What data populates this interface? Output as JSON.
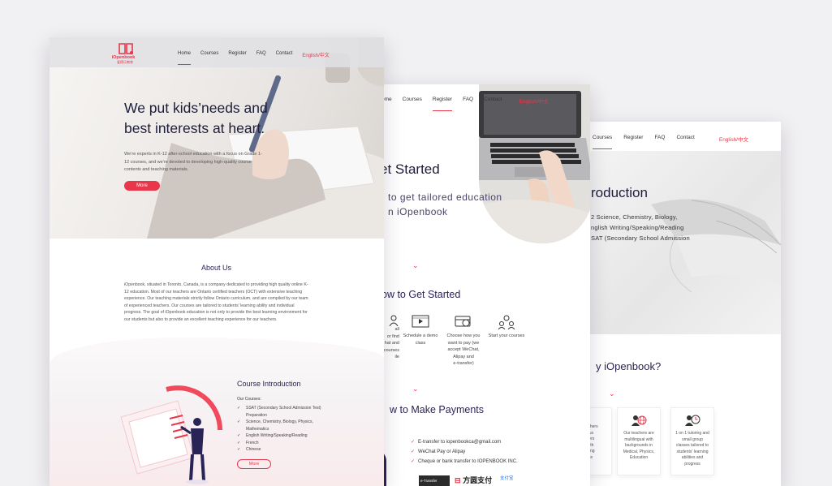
{
  "frame3": {
    "nav": {
      "courses": "Courses",
      "register": "Register",
      "faq": "FAQ",
      "contact": "Contact",
      "lang": "English/中文"
    },
    "hero_title": "roduction",
    "hero_lines": [
      "2 Science, Chemistry, Biology,",
      "nglish Writing/Speaking/Reading",
      "SAT (Secondary School Admission"
    ],
    "why_title": "y iOpenbook?",
    "chevron": "⌄",
    "cards": [
      {
        "icon": "teacher-icon",
        "lines": [
          "teachers",
          "ous",
          "ivers",
          "with",
          "uring",
          "ice"
        ]
      },
      {
        "icon": "multilingual-teacher-icon",
        "lines": [
          "Our teachers are",
          "multilingual with",
          "backgrounds in",
          "Medical, Physics,",
          "Education"
        ]
      },
      {
        "icon": "tutoring-clock-icon",
        "lines": [
          "1 on 1 tutoring and",
          "small group",
          "classes tailored to",
          "students' learning",
          "abilities and",
          "progress"
        ]
      }
    ]
  },
  "frame2": {
    "nav": {
      "home": "ome",
      "courses": "Courses",
      "register": "Register",
      "faq": "FAQ",
      "contact": "Contact",
      "lang": "English/中文"
    },
    "hero_title": "et Started",
    "hero_sub1": "to get tailored education",
    "hero_sub2": "n iOpenbook",
    "chevron": "⌄",
    "how_title": "ow to Get Started",
    "steps": [
      {
        "icon": "register-icon",
        "lines": [
          "all",
          "or find",
          "hat and",
          "courses",
          "ile"
        ]
      },
      {
        "icon": "demo-video-icon",
        "lines": [
          "Schedule a demo",
          "class"
        ]
      },
      {
        "icon": "payment-card-icon",
        "lines": [
          "Choose how you",
          "want to pay (we",
          "accept WeChat,",
          "Alipay and",
          "e-transfer)"
        ]
      },
      {
        "icon": "students-icon",
        "lines": [
          "Start your courses"
        ]
      }
    ],
    "pay_title": "w to Make Payments",
    "payments": [
      "E-transfer to iopenbookca@gmail.com",
      "WeChat Pay or Alipay",
      "Cheque or bank transfer to IOPENBOOK INC."
    ],
    "pay_logos": {
      "interac": "e-Transfer",
      "fangyuan": "方圆支付",
      "wechat": "支付宝"
    }
  },
  "frame1": {
    "logo": {
      "brand": "iOpenbook",
      "cn": "爱德乐教育"
    },
    "nav": {
      "home": "Home",
      "courses": "Courses",
      "register": "Register",
      "faq": "FAQ",
      "contact": "Contact",
      "lang": "English/中文"
    },
    "hero_title_1": "We put kids’needs and",
    "hero_title_2": "best interests at heart.",
    "hero_desc": "We’re experts in K-12 after-school education with a focus on Grade 1-12 courses, and we’re devoted to developing high-quality course contents and teaching materials.",
    "more": "More",
    "about_title": "About Us",
    "about_text": "iOpenbook, situated in Toronto, Canada, is a company dedicated to providing high quality online K-12 education. Most of our teachers are Ontario certified teachers (OCT) with extensive teaching experience. Our teaching materials strictly follow Ontario curriculum, and are compiled by our team of experienced teachers. Our courses are tailored to students' learning ability and individual progress. The goal of iOpenbook education is not only to provide the best learning environment for our students but also to provide an excellent teaching experience for our teachers.",
    "course_title": "Course Introduction",
    "our_courses": "Our Courses:",
    "courses": [
      "SSAT (Secondary School Admission Test) Preparation",
      "Science, Chemistry, Biology, Physics, Mathematics",
      "English Writing/Speaking/Reading",
      "French",
      "Chinese"
    ],
    "more2": "More"
  },
  "colors": {
    "accent": "#e8364a",
    "heading": "#2a2456"
  }
}
